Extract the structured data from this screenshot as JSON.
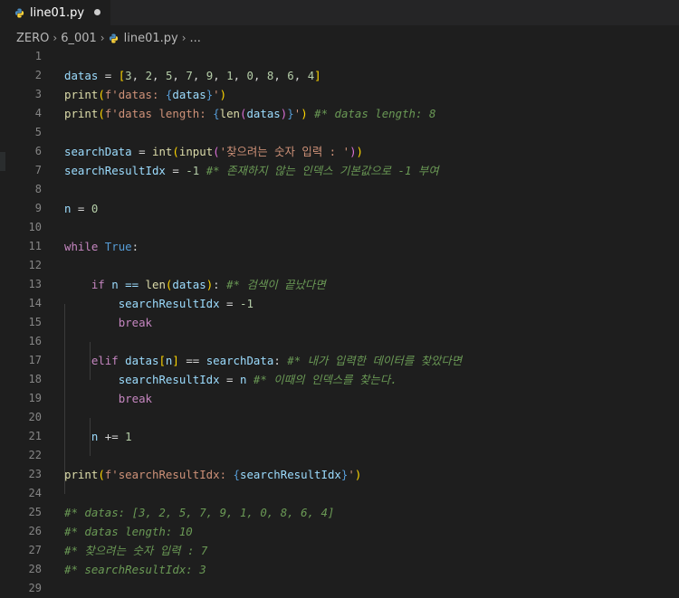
{
  "tab": {
    "label": "line01.py",
    "icon": "python-icon"
  },
  "breadcrumb": [
    "ZERO",
    "6_001",
    "line01.py",
    "..."
  ],
  "line_numbers": [
    "1",
    "2",
    "3",
    "4",
    "5",
    "6",
    "7",
    "8",
    "9",
    "10",
    "11",
    "12",
    "13",
    "14",
    "15",
    "16",
    "17",
    "18",
    "19",
    "20",
    "21",
    "22",
    "23",
    "24",
    "25",
    "26",
    "27",
    "28",
    "29"
  ],
  "code": [
    [],
    [
      [
        "datas",
        "var"
      ],
      [
        " = ",
        "op"
      ],
      [
        "[",
        "brk1"
      ],
      [
        "3",
        "num"
      ],
      [
        ", ",
        "op"
      ],
      [
        "2",
        "num"
      ],
      [
        ", ",
        "op"
      ],
      [
        "5",
        "num"
      ],
      [
        ", ",
        "op"
      ],
      [
        "7",
        "num"
      ],
      [
        ", ",
        "op"
      ],
      [
        "9",
        "num"
      ],
      [
        ", ",
        "op"
      ],
      [
        "1",
        "num"
      ],
      [
        ", ",
        "op"
      ],
      [
        "0",
        "num"
      ],
      [
        ", ",
        "op"
      ],
      [
        "8",
        "num"
      ],
      [
        ", ",
        "op"
      ],
      [
        "6",
        "num"
      ],
      [
        ", ",
        "op"
      ],
      [
        "4",
        "num"
      ],
      [
        "]",
        "brk1"
      ]
    ],
    [
      [
        "print",
        "fn"
      ],
      [
        "(",
        "brk1"
      ],
      [
        "f'datas: ",
        "str"
      ],
      [
        "{",
        "interp"
      ],
      [
        "datas",
        "var"
      ],
      [
        "}",
        "interp"
      ],
      [
        "'",
        "str"
      ],
      [
        ")",
        "brk1"
      ]
    ],
    [
      [
        "print",
        "fn"
      ],
      [
        "(",
        "brk1"
      ],
      [
        "f'datas length: ",
        "str"
      ],
      [
        "{",
        "interp"
      ],
      [
        "len",
        "fn"
      ],
      [
        "(",
        "brk2"
      ],
      [
        "datas",
        "var"
      ],
      [
        ")",
        "brk2"
      ],
      [
        "}",
        "interp"
      ],
      [
        "'",
        "str"
      ],
      [
        ")",
        "brk1"
      ],
      [
        " ",
        "op"
      ],
      [
        "#* datas length: 8",
        "cm"
      ]
    ],
    [],
    [
      [
        "searchData",
        "var"
      ],
      [
        " = ",
        "op"
      ],
      [
        "int",
        "fn"
      ],
      [
        "(",
        "brk1"
      ],
      [
        "input",
        "fn"
      ],
      [
        "(",
        "brk2"
      ],
      [
        "'찾으려는 숫자 입력 : '",
        "str"
      ],
      [
        ")",
        "brk2"
      ],
      [
        ")",
        "brk1"
      ]
    ],
    [
      [
        "searchResultIdx",
        "var"
      ],
      [
        " = ",
        "op"
      ],
      [
        "-1",
        "num"
      ],
      [
        " ",
        "op"
      ],
      [
        "#* 존재하지 않는 인덱스 기본값으로 -1 부여",
        "cm"
      ]
    ],
    [],
    [
      [
        "n",
        "var"
      ],
      [
        " = ",
        "op"
      ],
      [
        "0",
        "num"
      ]
    ],
    [],
    [
      [
        "while",
        "kw"
      ],
      [
        " ",
        "op"
      ],
      [
        "True",
        "const"
      ],
      [
        ":",
        "op"
      ]
    ],
    [],
    [
      [
        "    ",
        "op"
      ],
      [
        "if",
        "kw"
      ],
      [
        " n == ",
        "var"
      ],
      [
        "len",
        "fn"
      ],
      [
        "(",
        "brk1"
      ],
      [
        "datas",
        "var"
      ],
      [
        ")",
        "brk1"
      ],
      [
        ": ",
        "op"
      ],
      [
        "#* 검색이 끝났다면",
        "cm"
      ]
    ],
    [
      [
        "        ",
        "op"
      ],
      [
        "searchResultIdx",
        "var"
      ],
      [
        " = ",
        "op"
      ],
      [
        "-1",
        "num"
      ]
    ],
    [
      [
        "        ",
        "op"
      ],
      [
        "break",
        "kw"
      ]
    ],
    [],
    [
      [
        "    ",
        "op"
      ],
      [
        "elif",
        "kw"
      ],
      [
        " datas",
        "var"
      ],
      [
        "[",
        "brk1"
      ],
      [
        "n",
        "var"
      ],
      [
        "]",
        "brk1"
      ],
      [
        " == ",
        "op"
      ],
      [
        "searchData",
        "var"
      ],
      [
        ": ",
        "op"
      ],
      [
        "#* 내가 입력한 데이터를 찾았다면",
        "cm"
      ]
    ],
    [
      [
        "        ",
        "op"
      ],
      [
        "searchResultIdx",
        "var"
      ],
      [
        " = ",
        "op"
      ],
      [
        "n",
        "var"
      ],
      [
        " ",
        "op"
      ],
      [
        "#* 이때의 인덱스를 찾는다.",
        "cm"
      ]
    ],
    [
      [
        "        ",
        "op"
      ],
      [
        "break",
        "kw"
      ]
    ],
    [],
    [
      [
        "    ",
        "op"
      ],
      [
        "n",
        "var"
      ],
      [
        " += ",
        "op"
      ],
      [
        "1",
        "num"
      ]
    ],
    [],
    [
      [
        "print",
        "fn"
      ],
      [
        "(",
        "brk1"
      ],
      [
        "f'searchResultIdx: ",
        "str"
      ],
      [
        "{",
        "interp"
      ],
      [
        "searchResultIdx",
        "var"
      ],
      [
        "}",
        "interp"
      ],
      [
        "'",
        "str"
      ],
      [
        ")",
        "brk1"
      ]
    ],
    [],
    [
      [
        "#* datas: [3, 2, 5, 7, 9, 1, 0, 8, 6, 4]",
        "cm"
      ]
    ],
    [
      [
        "#* datas length: 10",
        "cm"
      ]
    ],
    [
      [
        "#* 찾으려는 숫자 입력 : 7",
        "cm"
      ]
    ],
    [
      [
        "#* searchResultIdx: 3",
        "cm"
      ]
    ],
    []
  ]
}
